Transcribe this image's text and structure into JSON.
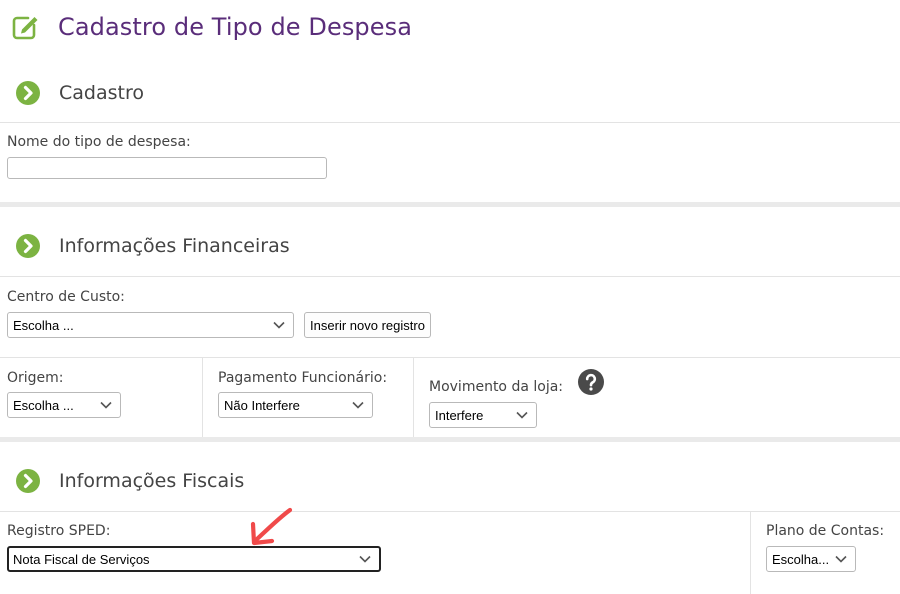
{
  "page": {
    "title": "Cadastro de Tipo de Despesa",
    "title_icon": "edit-icon"
  },
  "colors": {
    "title": "#5a2d7a",
    "section_icon": "#7cb342",
    "annotation_arrow": "#f04a4a",
    "help_icon": "#4a4a4a"
  },
  "sections": {
    "cadastro": {
      "title": "Cadastro",
      "icon": "chevron-right-circle-icon",
      "nome_label": "Nome do tipo de despesa:",
      "nome_value": ""
    },
    "financeiras": {
      "title": "Informações Financeiras",
      "icon": "chevron-right-circle-icon",
      "centro_custo_label": "Centro de Custo:",
      "centro_custo_value": "Escolha ...",
      "inserir_button": "Inserir novo registro",
      "origem_label": "Origem:",
      "origem_value": "Escolha ...",
      "pagamento_label": "Pagamento Funcionário:",
      "pagamento_value": "Não Interfere",
      "movimento_label": "Movimento da loja:",
      "movimento_value": "Interfere",
      "help_icon": "question-circle-icon"
    },
    "fiscais": {
      "title": "Informações Fiscais",
      "icon": "chevron-right-circle-icon",
      "sped_label": "Registro SPED:",
      "sped_value": "Nota Fiscal de Serviços",
      "plano_label": "Plano de Contas:",
      "plano_value": "Escolha..."
    }
  },
  "annotation": {
    "icon": "red-arrow-icon"
  }
}
